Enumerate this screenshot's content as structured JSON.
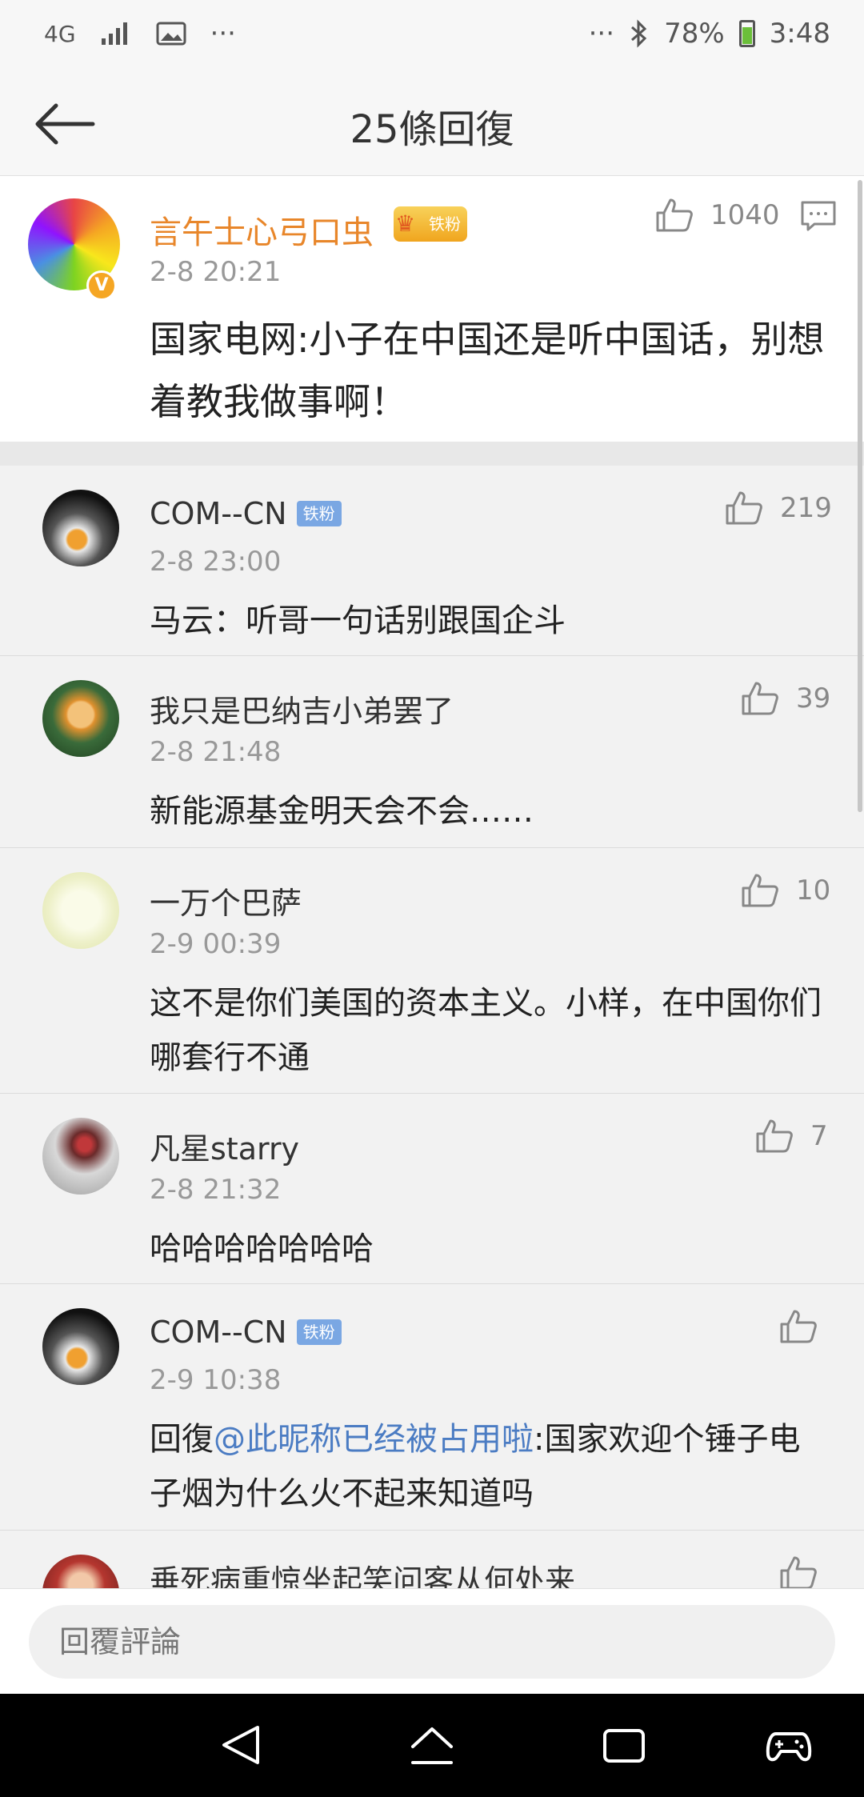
{
  "status_bar": {
    "network": "4G",
    "overflow": "···",
    "right_overflow": "···",
    "battery": "78%",
    "time": "3:48"
  },
  "header": {
    "title": "25條回復"
  },
  "main_comment": {
    "author": "言午士心弓口虫",
    "fan_badge": "铁粉",
    "crown_level": "5",
    "verified": "V",
    "time": "2-8 20:21",
    "likes": "1040",
    "text": "国家电网:小子在中国还是听中国话，别想着教我做事啊！"
  },
  "replies": [
    {
      "author": "COM--CN",
      "badge": "铁粉",
      "time": "2-8 23:00",
      "likes": "219",
      "text": "马云：听哥一句话别跟国企斗"
    },
    {
      "author": "我只是巴纳吉小弟罢了",
      "badge": "",
      "time": "2-8 21:48",
      "likes": "39",
      "text": "新能源基金明天会不会……"
    },
    {
      "author": "一万个巴萨",
      "badge": "",
      "time": "2-9 00:39",
      "likes": "10",
      "text": "这不是你们美国的资本主义。小样，在中国你们哪套行不通"
    },
    {
      "author": "凡星starry",
      "badge": "",
      "time": "2-8 21:32",
      "likes": "7",
      "text": "哈哈哈哈哈哈哈"
    },
    {
      "author": "COM--CN",
      "badge": "铁粉",
      "time": "2-9 10:38",
      "likes": "",
      "text_prefix": "回復",
      "mention": "@此昵称已经被占用啦",
      "text": ":国家欢迎个锤子电子烟为什么火不起来知道吗"
    },
    {
      "author": "垂死病重惊坐起笑问客从何处来",
      "badge": "",
      "time": "",
      "likes": "",
      "text": ""
    }
  ],
  "input": {
    "placeholder": "回覆評論"
  }
}
